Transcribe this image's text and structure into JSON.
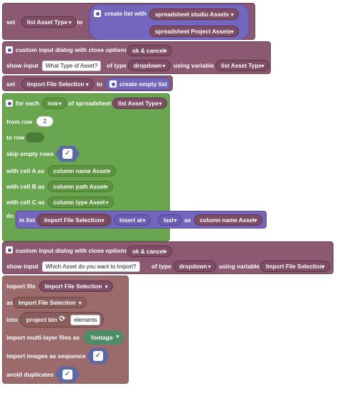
{
  "block1": {
    "set": "set",
    "var": "list Asset Type",
    "to": "to",
    "create_list_with": "create list with",
    "item1": "spreadsheet studio Assets",
    "item2": "spreadsheet Project Assets"
  },
  "block2": {
    "title": "custom input dialog with close options",
    "options": "ok & cancel",
    "show_input": "show input",
    "prompt": "What Type of Asset?",
    "of_type": "of type",
    "type": "dropdown",
    "using_variable": "using variable",
    "variable": "list Asset Type"
  },
  "block3": {
    "set": "set",
    "var": "Import File Selection",
    "to": "to",
    "create_empty_list": "create empty list"
  },
  "block4": {
    "for_each": "for each",
    "row": "row",
    "of_spreadsheet": "of spreadsheet",
    "sheet": "list Asset Type",
    "from_row": "from row",
    "from_value": "2",
    "to_row": "to row",
    "skip_empty": "skip empty rows",
    "cell_a": "with cell A as",
    "cell_a_var": "column name Asset",
    "cell_b": "with cell B as",
    "cell_b_var": "column path Asset",
    "cell_c": "with cell C as",
    "cell_c_var": "column type Asset",
    "do": "do",
    "in_list": "in list",
    "list_var": "Import File Selection",
    "insert_at": "insert at",
    "position": "last",
    "as": "as",
    "value_var": "column name Asset"
  },
  "block5": {
    "title": "custom input dialog with close options",
    "options": "ok & cancel",
    "show_input": "show input",
    "prompt": "Which Asset do you want to Import?",
    "of_type": "of type",
    "type": "dropdown",
    "using_variable": "using variable",
    "variable": "Import File Selection"
  },
  "block6": {
    "import_file": "import file",
    "file_var": "Import File Selection",
    "as": "as",
    "as_var": "Import File Selection",
    "into": "into",
    "bin": "project bin",
    "bin_value": "elements",
    "multi_layer": "import multi-layer files as",
    "multi_value": "footage",
    "sequence": "import images as sequence",
    "avoid_dup": "avoid duplicates"
  },
  "icons": {
    "gear": "gear-icon",
    "check": "checkmark-icon",
    "refresh": "refresh-icon",
    "dropdown": "chevron-down-icon"
  },
  "colors": {
    "plum": "#8b5a72",
    "green": "#6aa64f",
    "brown": "#9b6b6b",
    "purple": "#7466bd"
  }
}
